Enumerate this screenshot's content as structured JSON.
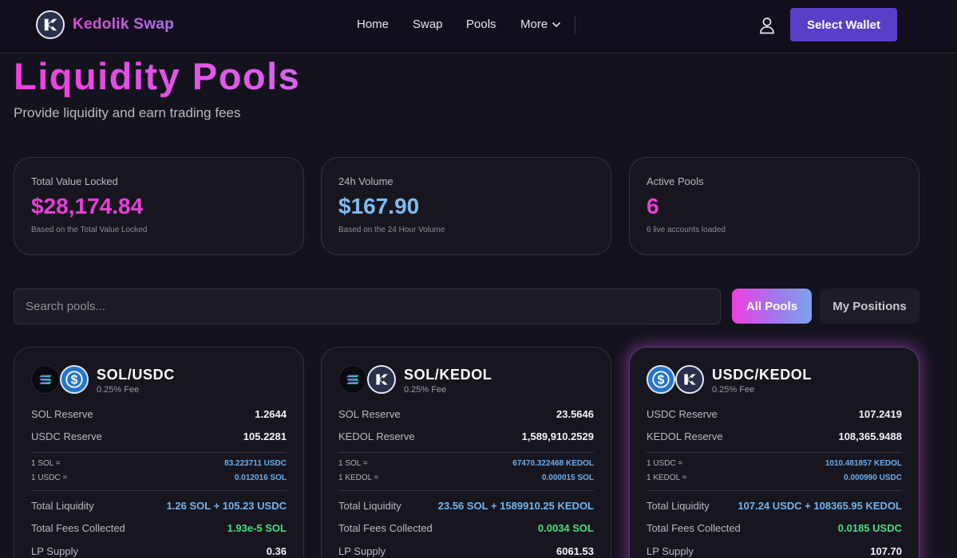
{
  "header": {
    "brand": "Kedolik Swap",
    "nav": [
      "Home",
      "Swap",
      "Pools",
      "More"
    ],
    "wallet_button": "Select Wallet"
  },
  "page": {
    "title": "Liquidity Pools",
    "subtitle": "Provide liquidity and earn trading fees"
  },
  "stats": [
    {
      "label": "Total Value Locked",
      "value": "$28,174.84",
      "note": "Based on the Total Value Locked"
    },
    {
      "label": "24h Volume",
      "value": "$167.90",
      "note": "Based on the 24 Hour Volume"
    },
    {
      "label": "Active Pools",
      "value": "6",
      "note": "6 live accounts loaded"
    }
  ],
  "search": {
    "placeholder": "Search pools..."
  },
  "filters": {
    "all": "All Pools",
    "mine": "My Positions"
  },
  "pools": [
    {
      "pair": "SOL/USDC",
      "fee": "0.25% Fee",
      "reserve_a_label": "SOL Reserve",
      "reserve_a_value": "1.2644",
      "reserve_b_label": "USDC Reserve",
      "reserve_b_value": "105.2281",
      "rate_a_label": "1 SOL =",
      "rate_a_value": "83.223711 USDC",
      "rate_b_label": "1 USDC =",
      "rate_b_value": "0.012016 SOL",
      "liquidity_label": "Total Liquidity",
      "liquidity_value": "1.26 SOL + 105.23 USDC",
      "fees_label": "Total Fees Collected",
      "fees_value": "1.93e-5 SOL",
      "supply_label": "LP Supply",
      "supply_value": "0.36"
    },
    {
      "pair": "SOL/KEDOL",
      "fee": "0.25% Fee",
      "reserve_a_label": "SOL Reserve",
      "reserve_a_value": "23.5646",
      "reserve_b_label": "KEDOL Reserve",
      "reserve_b_value": "1,589,910.2529",
      "rate_a_label": "1 SOL =",
      "rate_a_value": "67470.322468 KEDOL",
      "rate_b_label": "1 KEDOL =",
      "rate_b_value": "0.000015 SOL",
      "liquidity_label": "Total Liquidity",
      "liquidity_value": "23.56 SOL + 1589910.25 KEDOL",
      "fees_label": "Total Fees Collected",
      "fees_value": "0.0034 SOL",
      "supply_label": "LP Supply",
      "supply_value": "6061.53"
    },
    {
      "pair": "USDC/KEDOL",
      "fee": "0.25% Fee",
      "reserve_a_label": "USDC Reserve",
      "reserve_a_value": "107.2419",
      "reserve_b_label": "KEDOL Reserve",
      "reserve_b_value": "108,365.9488",
      "rate_a_label": "1 USDC =",
      "rate_a_value": "1010.481857 KEDOL",
      "rate_b_label": "1 KEDOL =",
      "rate_b_value": "0.000990 USDC",
      "liquidity_label": "Total Liquidity",
      "liquidity_value": "107.24 USDC + 108365.95 KEDOL",
      "fees_label": "Total Fees Collected",
      "fees_value": "0.0185 USDC",
      "supply_label": "LP Supply",
      "supply_value": "107.70"
    }
  ],
  "colors": {
    "background": "#14131d",
    "accent_pink": "#ea3ed8",
    "accent_blue": "#7fbcef",
    "accent_green": "#4ade80",
    "wallet_button": "#5a3ec8"
  }
}
